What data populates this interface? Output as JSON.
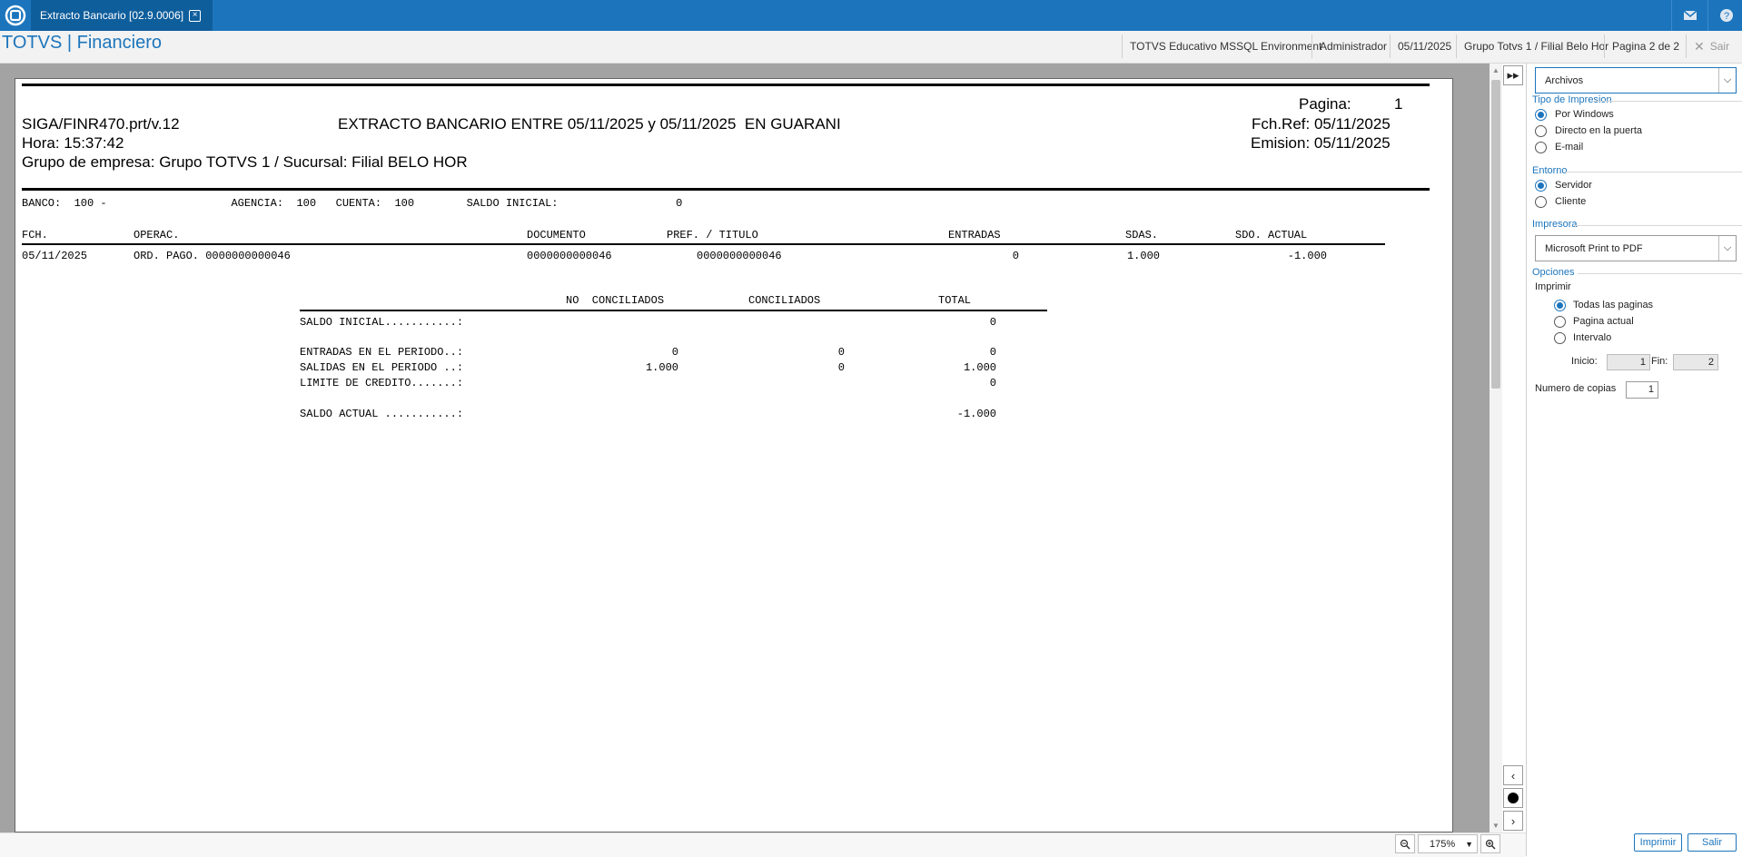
{
  "window": {
    "tab_title": "Extracto Bancario [02.9.0006]",
    "app_title": "TOTVS | Financiero"
  },
  "status": {
    "environment": "TOTVS Educativo MSSQL Environment",
    "user": "Administrador",
    "date": "05/11/2025",
    "group": "Grupo Totvs 1 / Filial Belo Hor",
    "page": "Pagina 2 de 2",
    "exit": "Sair"
  },
  "report": {
    "page_label": "Pagina:",
    "page_num": "1",
    "program": "SIGA/FINR470.prt/v.12",
    "title": "EXTRACTO BANCARIO ENTRE 05/11/2025 y 05/11/2025  EN GUARANI",
    "fch_ref": "Fch.Ref: 05/11/2025",
    "hora": "Hora: 15:37:42",
    "emision": "Emision: 05/11/2025",
    "grupo": "Grupo de empresa: Grupo TOTVS 1 / Sucursal: Filial BELO HOR",
    "bank_line": "BANCO:  100 -                   AGENCIA:  100   CUENTA:  100        SALDO INICIAL:                  0",
    "columns": [
      "FCH.",
      "OPERAC.",
      "DOCUMENTO",
      "PREF. / TITULO",
      "ENTRADAS",
      "SDAS.",
      "SDO. ACTUAL"
    ],
    "rows": [
      [
        "05/11/2025",
        "ORD. PAGO. 0000000000046",
        "0000000000046",
        "0000000000046",
        "0",
        "1.000",
        "-1.000"
      ]
    ],
    "summary_header": [
      "NO  CONCILIADOS",
      "CONCILIADOS",
      "TOTAL"
    ],
    "summary": [
      {
        "label": "SALDO INICIAL...........:",
        "no_conc": "",
        "conc": "",
        "total": "0"
      },
      {
        "label": "ENTRADAS EN EL PERIODO..:",
        "no_conc": "0",
        "conc": "0",
        "total": "0"
      },
      {
        "label": "SALIDAS EN EL PERIODO ..:",
        "no_conc": "1.000",
        "conc": "0",
        "total": "1.000"
      },
      {
        "label": "LIMITE DE CREDITO.......:",
        "no_conc": "",
        "conc": "",
        "total": "0"
      },
      {
        "label": "SALDO ACTUAL ...........:",
        "no_conc": "",
        "conc": "",
        "total": "-1.000"
      }
    ]
  },
  "zoom": {
    "value": "175%"
  },
  "panel": {
    "destino": "Archivos",
    "tipo_label": "Tipo de Impresion",
    "tipo_options": [
      "Por Windows",
      "Directo en la puerta",
      "E-mail"
    ],
    "entorno_label": "Entorno",
    "entorno_options": [
      "Servidor",
      "Cliente"
    ],
    "impresora_label": "Impresora",
    "impresora_value": "Microsoft Print to PDF",
    "opciones_label": "Opciones",
    "imprimir_label": "Imprimir",
    "imprimir_options": [
      "Todas las paginas",
      "Pagina actual",
      "Intervalo"
    ],
    "inicio_label": "Inicio:",
    "inicio_value": "1",
    "fin_label": "Fin:",
    "fin_value": "2",
    "copias_label": "Numero de copias",
    "copias_value": "1",
    "print_button": "Imprimir",
    "exit_button": "Salir"
  }
}
